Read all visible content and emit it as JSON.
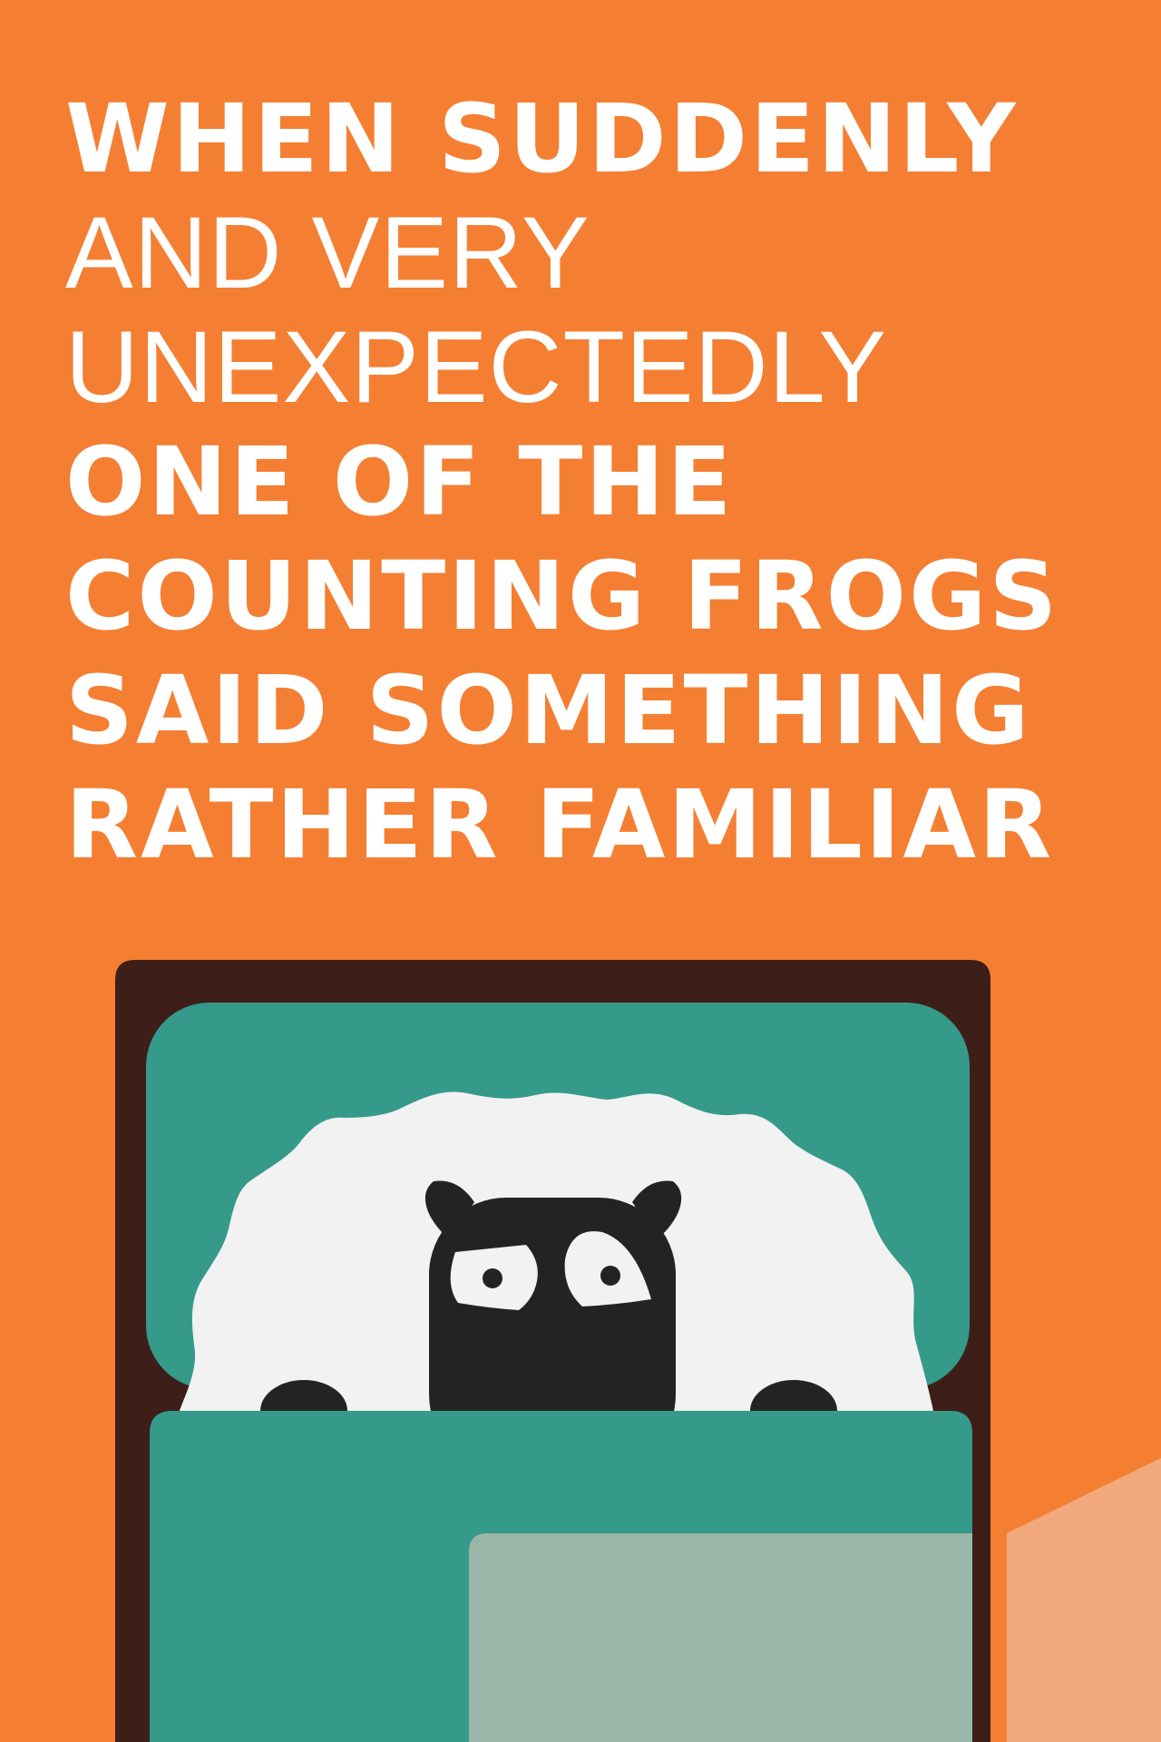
{
  "story": {
    "lines": [
      "WHEN SUDDENLY",
      "AND VERY",
      "UNEXPECTEDLY",
      "ONE OF THE",
      "COUNTING FROGS",
      "SAID SOMETHING",
      "RATHER FAMILIAR"
    ]
  },
  "colors": {
    "background": "#F47F33",
    "text": "#FFFFFF",
    "bed_frame": "#3D1E18",
    "sheet": "#359A89",
    "sheet_fold": "#9AB6A8",
    "wool": "#F2F2F2",
    "sheep_face": "#232323",
    "side_block": "#F2AA7C"
  },
  "illustration": {
    "subject": "sheep-in-bed"
  }
}
